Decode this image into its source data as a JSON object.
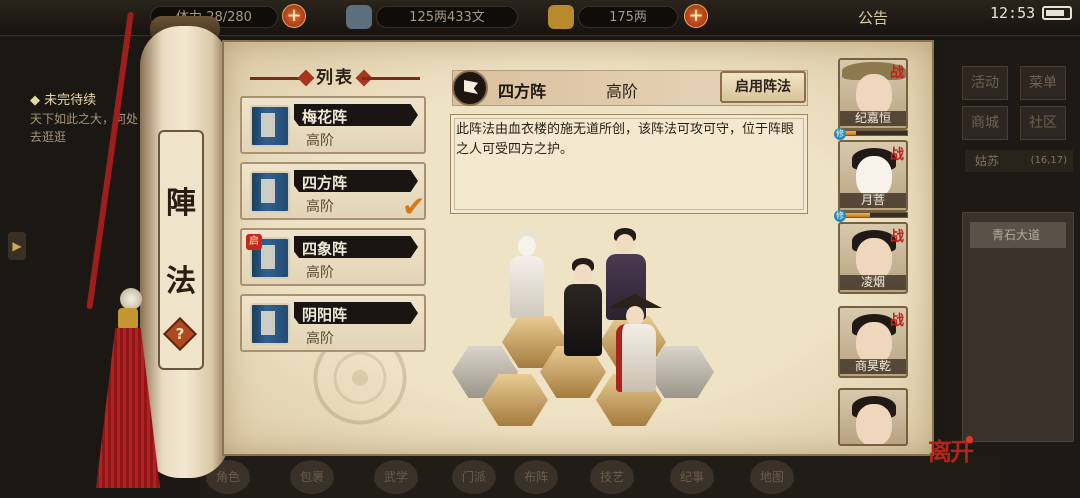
{
  "topbar": {
    "stamina_label": "体力",
    "stamina_value": "28/280",
    "money_value": "125两433文",
    "ingot_value": "175两",
    "notice_label": "公告",
    "clock": "12:53"
  },
  "left_quest": {
    "title": "◆ 未完待续",
    "desc": "天下如此之大，何处去逛逛"
  },
  "scroll": {
    "title_char_1": "陣",
    "title_char_2": "法",
    "help_label": "?"
  },
  "list": {
    "header": "列表",
    "items": [
      {
        "name": "梅花阵",
        "tier": "高阶"
      },
      {
        "name": "四方阵",
        "tier": "高阶"
      },
      {
        "name": "四象阵",
        "tier": "高阶",
        "badge": "启"
      },
      {
        "name": "阴阳阵",
        "tier": "高阶"
      }
    ],
    "selected_index": 1
  },
  "detail": {
    "name": "四方阵",
    "tier": "高阶",
    "enable_label": "启用阵法",
    "description": "此阵法由血衣楼的施无道所创，该阵法可攻可守，位于阵眼之人可受四方之护。"
  },
  "party": [
    {
      "name": "纪嘉恒",
      "tag": "战",
      "hp": 0.25
    },
    {
      "name": "月菩",
      "tag": "战",
      "hp": 0.45
    },
    {
      "name": "凌烟",
      "tag": "战"
    },
    {
      "name": "商昊乾",
      "tag": "战"
    },
    {
      "name": "",
      "tag": ""
    }
  ],
  "right_side": {
    "buttons": [
      "活动",
      "菜单",
      "商城",
      "社区"
    ],
    "location": "姑苏",
    "coords": "(16,17)",
    "road": "青石大道"
  },
  "bottom_bar": [
    "角色",
    "包裹",
    "武学",
    "门派",
    "布阵",
    "技艺",
    "纪事",
    "地图"
  ],
  "leave_label": "离开",
  "colors": {
    "accent_red": "#b3251b",
    "paper": "#efe3c6",
    "check_orange": "#d9771c"
  }
}
